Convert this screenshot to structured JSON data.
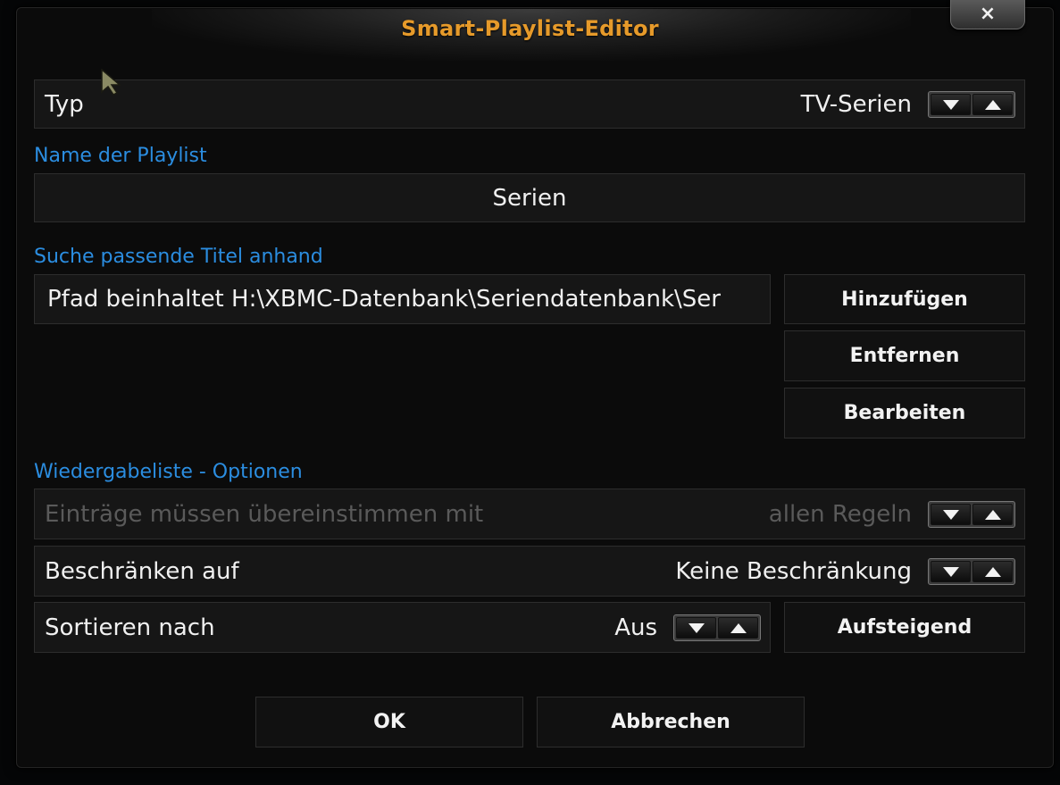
{
  "dialog": {
    "title": "Smart-Playlist-Editor",
    "close_label": "×"
  },
  "type_row": {
    "label": "Typ",
    "value": "TV-Serien"
  },
  "playlist_name": {
    "section_label": "Name der Playlist",
    "value": "Serien"
  },
  "rules": {
    "section_label": "Suche passende Titel anhand",
    "items": [
      "Pfad beinhaltet H:\\XBMC-Datenbank\\Seriendatenbank\\Ser"
    ],
    "add_label": "Hinzufügen",
    "remove_label": "Entfernen",
    "edit_label": "Bearbeiten"
  },
  "options": {
    "section_label": "Wiedergabeliste - Optionen",
    "match": {
      "label": "Einträge müssen übereinstimmen mit",
      "value": "allen Regeln",
      "enabled": false
    },
    "limit": {
      "label": "Beschränken auf",
      "value": "Keine Beschränkung"
    },
    "sort": {
      "label": "Sortieren nach",
      "value": "Aus",
      "order_label": "Aufsteigend"
    }
  },
  "footer": {
    "ok_label": "OK",
    "cancel_label": "Abbrechen"
  },
  "colors": {
    "title": "#e69a2a",
    "section_label": "#2b8de0",
    "background": "#0b0b0b",
    "disabled_text": "#5a5a5a"
  },
  "icons": {
    "close": "close-icon",
    "spin_down": "triangle-down-icon",
    "spin_up": "triangle-up-icon",
    "cursor": "mouse-pointer-icon"
  }
}
